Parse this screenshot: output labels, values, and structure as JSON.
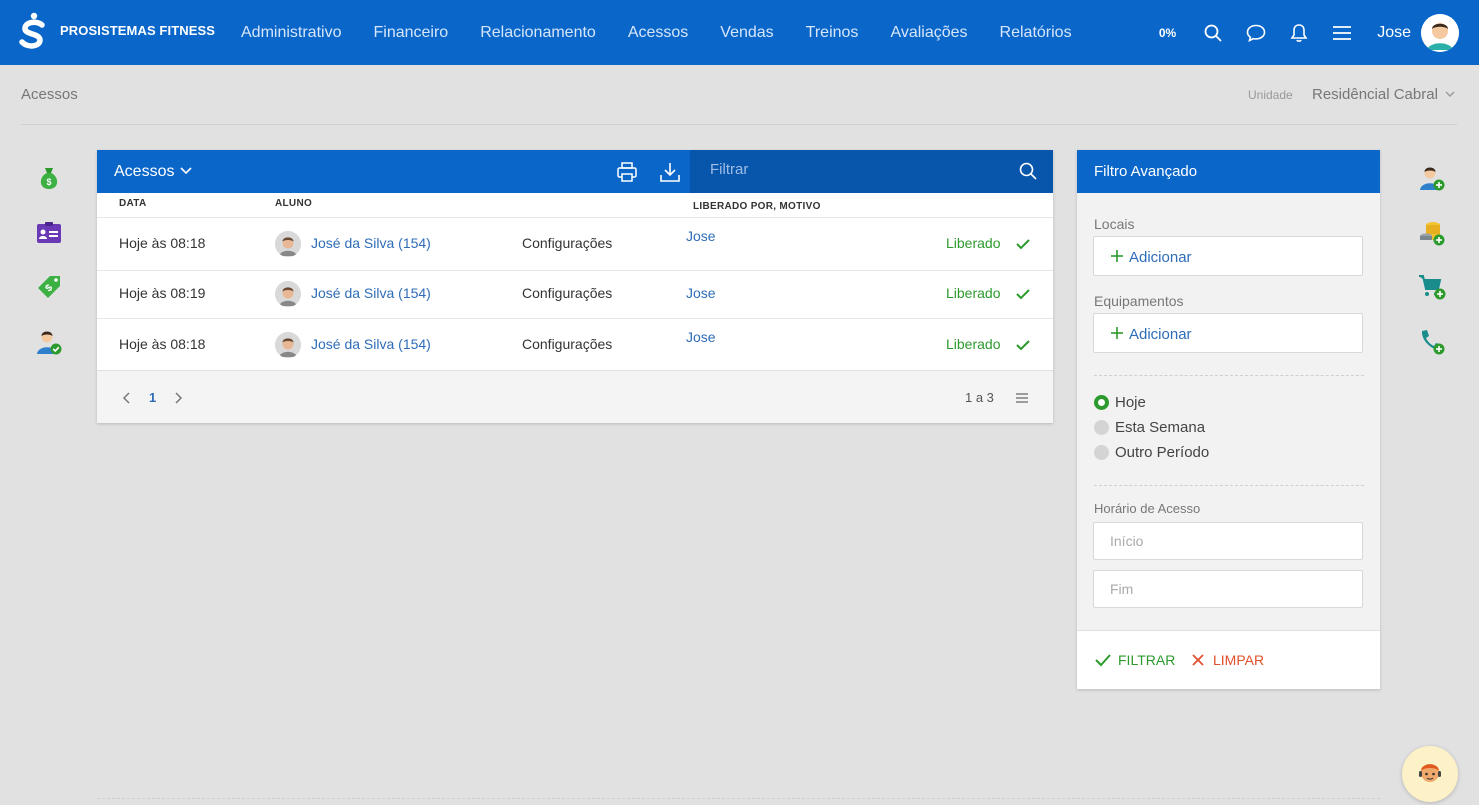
{
  "app": {
    "brand": "PROSISTEMAS FITNESS",
    "nav": [
      "Administrativo",
      "Financeiro",
      "Relacionamento",
      "Acessos",
      "Vendas",
      "Treinos",
      "Avaliações",
      "Relatórios"
    ],
    "progress": "0%",
    "user": "Jose",
    "accent": "#0a67c9"
  },
  "page": {
    "breadcrumb": "Acessos",
    "unit_label": "Unidade",
    "unit_value": "Residêncial Cabral"
  },
  "side_icons_left": [
    "money-bag-icon",
    "id-card-icon",
    "price-tag-icon",
    "user-check-icon"
  ],
  "side_icons_right": [
    "add-user-icon",
    "add-coins-icon",
    "add-cart-icon",
    "add-phone-icon"
  ],
  "table": {
    "title": "Acessos",
    "filter_placeholder": "Filtrar",
    "columns": {
      "date": "DATA",
      "student": "ALUNO",
      "released_by": "LIBERADO POR, MOTIVO"
    },
    "rows": [
      {
        "date": "Hoje às 08:18",
        "student": "José da Silva (154)",
        "config": "Configurações",
        "by": "Jose",
        "status": "Liberado"
      },
      {
        "date": "Hoje às 08:19",
        "student": "José da Silva (154)",
        "config": "Configurações",
        "by": "Jose",
        "status": "Liberado"
      },
      {
        "date": "Hoje às 08:18",
        "student": "José da Silva (154)",
        "config": "Configurações",
        "by": "Jose",
        "status": "Liberado"
      }
    ],
    "page": "1",
    "count": "1 a 3"
  },
  "filter": {
    "title": "Filtro Avançado",
    "locais_label": "Locais",
    "equip_label": "Equipamentos",
    "add_label": "Adicionar",
    "periods": [
      {
        "label": "Hoje",
        "selected": true
      },
      {
        "label": "Esta Semana",
        "selected": false
      },
      {
        "label": "Outro Período",
        "selected": false
      }
    ],
    "time_label": "Horário de Acesso",
    "start_placeholder": "Início",
    "end_placeholder": "Fim",
    "apply_label": "FILTRAR",
    "clear_label": "LIMPAR"
  }
}
